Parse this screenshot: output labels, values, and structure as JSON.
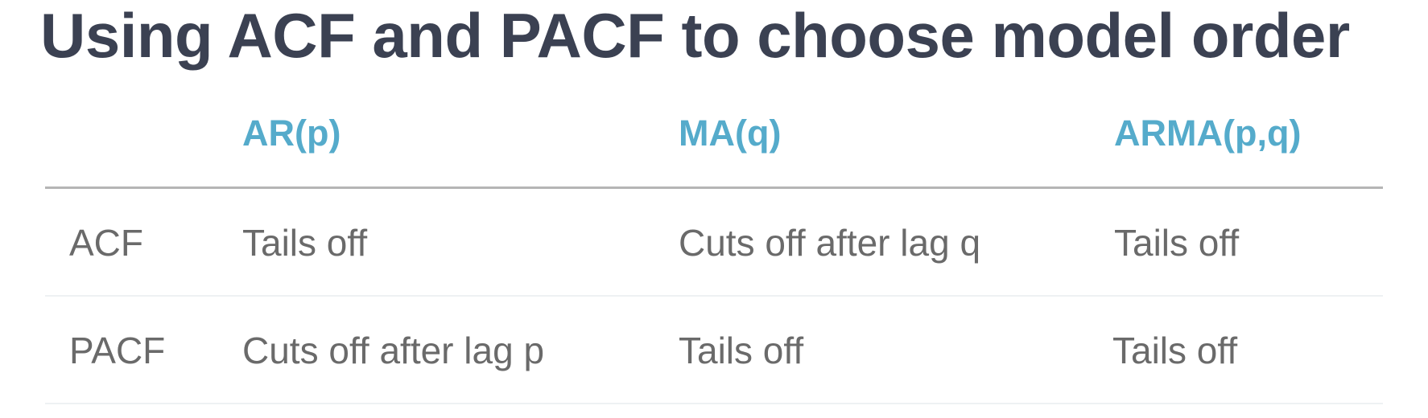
{
  "title": "Using ACF and PACF to choose model order",
  "table": {
    "columns": [
      "",
      "AR(p)",
      "MA(q)",
      "ARMA(p,q)"
    ],
    "rows": [
      {
        "label": "ACF",
        "cells": [
          "Tails off",
          "Cuts off after lag q",
          "Tails off"
        ]
      },
      {
        "label": "PACF",
        "cells": [
          "Cuts off after lag p",
          "Tails off",
          "Tails off"
        ]
      }
    ]
  },
  "colors": {
    "title": "#3b4152",
    "header_text": "#55abcb",
    "body_text": "#6a6a6a",
    "header_rule": "#b5b5b5",
    "row_rule": "#eef1f3"
  }
}
